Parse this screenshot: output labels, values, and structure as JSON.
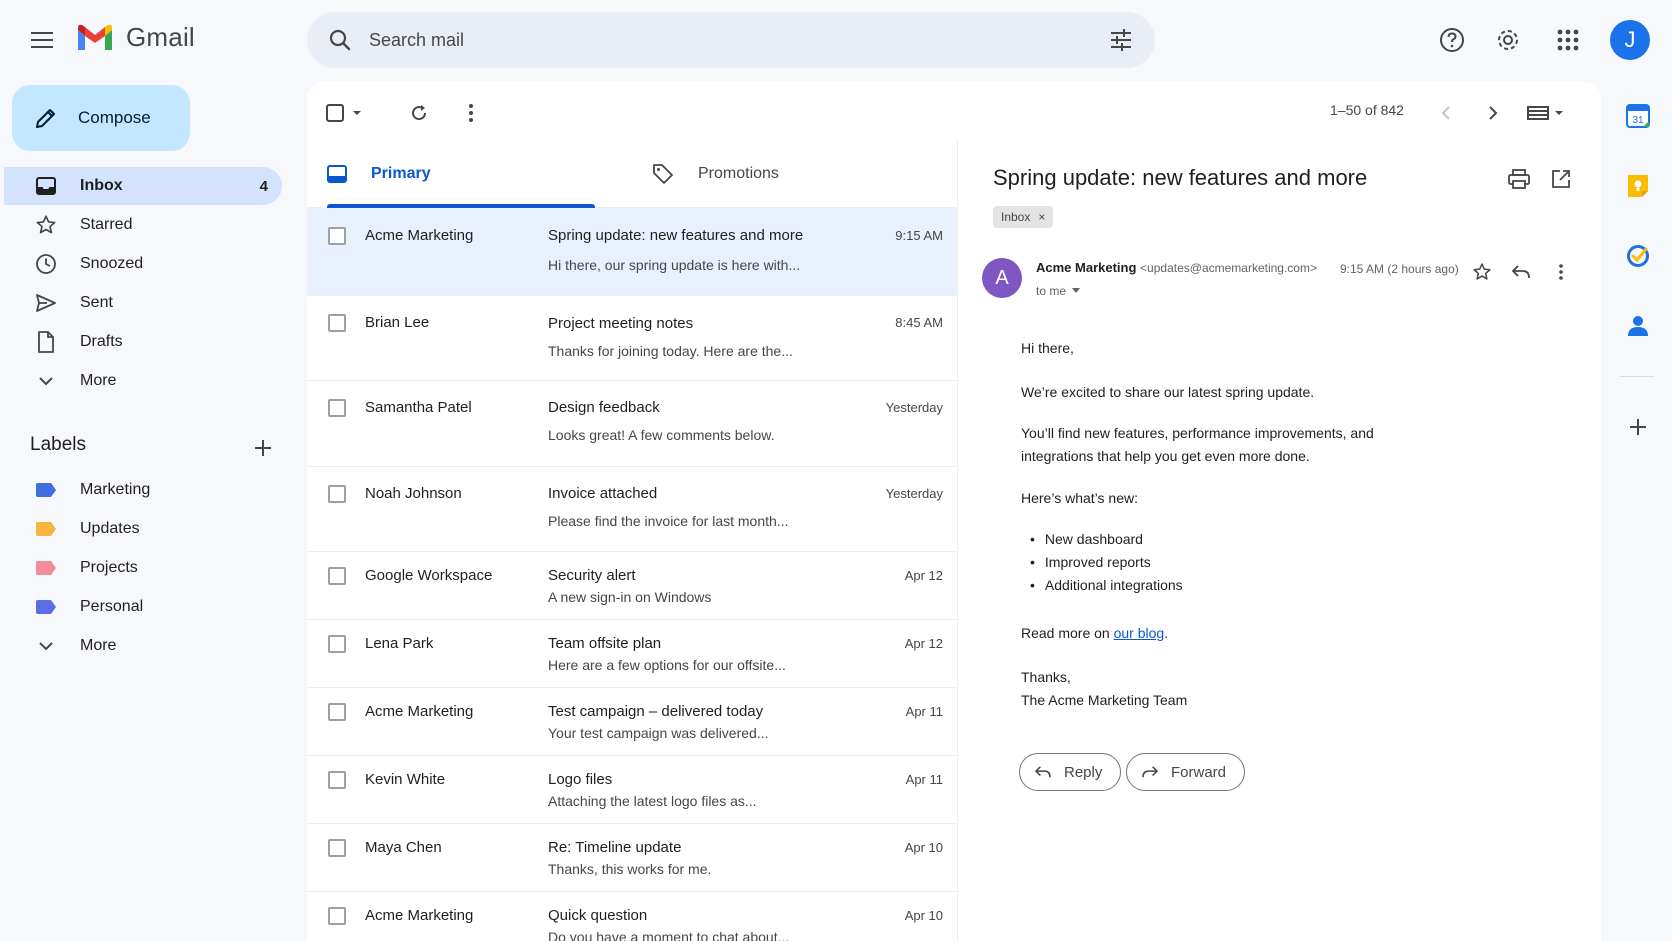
{
  "app": {
    "name": "Gmail",
    "user_initial": "J"
  },
  "colors": {
    "accent": "#0b57d0",
    "compose_bg": "#c2e7ff",
    "active_nav": "#d3e3fd",
    "selected_row": "#e8f0fe"
  },
  "search": {
    "placeholder": "Search mail"
  },
  "sidebar": {
    "compose_label": "Compose",
    "items": [
      {
        "label": "Inbox",
        "count": "4",
        "icon": "inbox-icon"
      },
      {
        "label": "Starred",
        "count": "",
        "icon": "star-icon"
      },
      {
        "label": "Snoozed",
        "count": "",
        "icon": "clock-icon"
      },
      {
        "label": "Sent",
        "count": "",
        "icon": "send-icon"
      },
      {
        "label": "Drafts",
        "count": "",
        "icon": "draft-icon"
      },
      {
        "label": "More",
        "count": "",
        "icon": "chevron-down-icon"
      }
    ],
    "labels_title": "Labels",
    "labels": [
      {
        "label": "Marketing",
        "color": "#3f6ee0"
      },
      {
        "label": "Updates",
        "color": "#f4b63f"
      },
      {
        "label": "Projects",
        "color": "#f28b9b"
      },
      {
        "label": "Personal",
        "color": "#5b6ee8"
      }
    ],
    "labels_more": "More"
  },
  "toolbar": {
    "pager": "1–50 of 842"
  },
  "tabs": [
    {
      "label": "Primary",
      "icon": "inbox-icon"
    },
    {
      "label": "Promotions",
      "icon": "tag-icon"
    }
  ],
  "emails": [
    {
      "sender": "Acme Marketing",
      "subject": "Spring update: new features and more",
      "snippet": "Hi there, our spring update is here with...",
      "date": "9:15 AM"
    },
    {
      "sender": "Brian Lee",
      "subject": "Project meeting notes",
      "snippet": "Thanks for joining today. Here are the...",
      "date": "8:45 AM"
    },
    {
      "sender": "Samantha Patel",
      "subject": "Design feedback",
      "snippet": "Looks great! A few comments below.",
      "date": "Yesterday"
    },
    {
      "sender": "Noah Johnson",
      "subject": "Invoice attached",
      "snippet": "Please find the invoice for last month...",
      "date": "Yesterday"
    },
    {
      "sender": "Google Workspace",
      "subject": "Security alert",
      "snippet": "A new sign-in on Windows",
      "date": "Apr 12"
    },
    {
      "sender": "Lena Park",
      "subject": "Team offsite plan",
      "snippet": "Here are a few options for our offsite...",
      "date": "Apr 12"
    },
    {
      "sender": "Acme Marketing",
      "subject": "Test campaign – delivered today",
      "snippet": "Your test campaign was delivered...",
      "date": "Apr 11"
    },
    {
      "sender": "Kevin White",
      "subject": "Logo files",
      "snippet": "Attaching the latest logo files as...",
      "date": "Apr 11"
    },
    {
      "sender": "Maya Chen",
      "subject": "Re: Timeline update",
      "snippet": "Thanks, this works for me.",
      "date": "Apr 10"
    },
    {
      "sender": "Acme Marketing",
      "subject": "Quick question",
      "snippet": "Do you have a moment to chat about...",
      "date": "Apr 10"
    }
  ],
  "reading": {
    "subject": "Spring update: new features and more",
    "chip": "Inbox",
    "chip_close": "×",
    "sender_initial": "A",
    "sender_name": "Acme Marketing",
    "sender_email": "<updates@acmemarketing.com>",
    "to": "to me",
    "time": "9:15 AM (2 hours ago)",
    "greeting": "Hi there,",
    "para1": "We’re excited to share our latest spring update.",
    "para2_line1": "You’ll find new features, performance improvements, and",
    "para2_line2": "integrations that help you get even more done.",
    "para3": "Here’s what’s new:",
    "bullets": [
      "New dashboard",
      "Improved reports",
      "Additional integrations"
    ],
    "read_more": "Read more on ",
    "link_text": "our blog",
    "period": ".",
    "signoff": "Thanks,",
    "signature": "The Acme Marketing Team",
    "reply_label": "Reply",
    "forward_label": "Forward"
  },
  "rail": {
    "calendar_day": "31"
  }
}
